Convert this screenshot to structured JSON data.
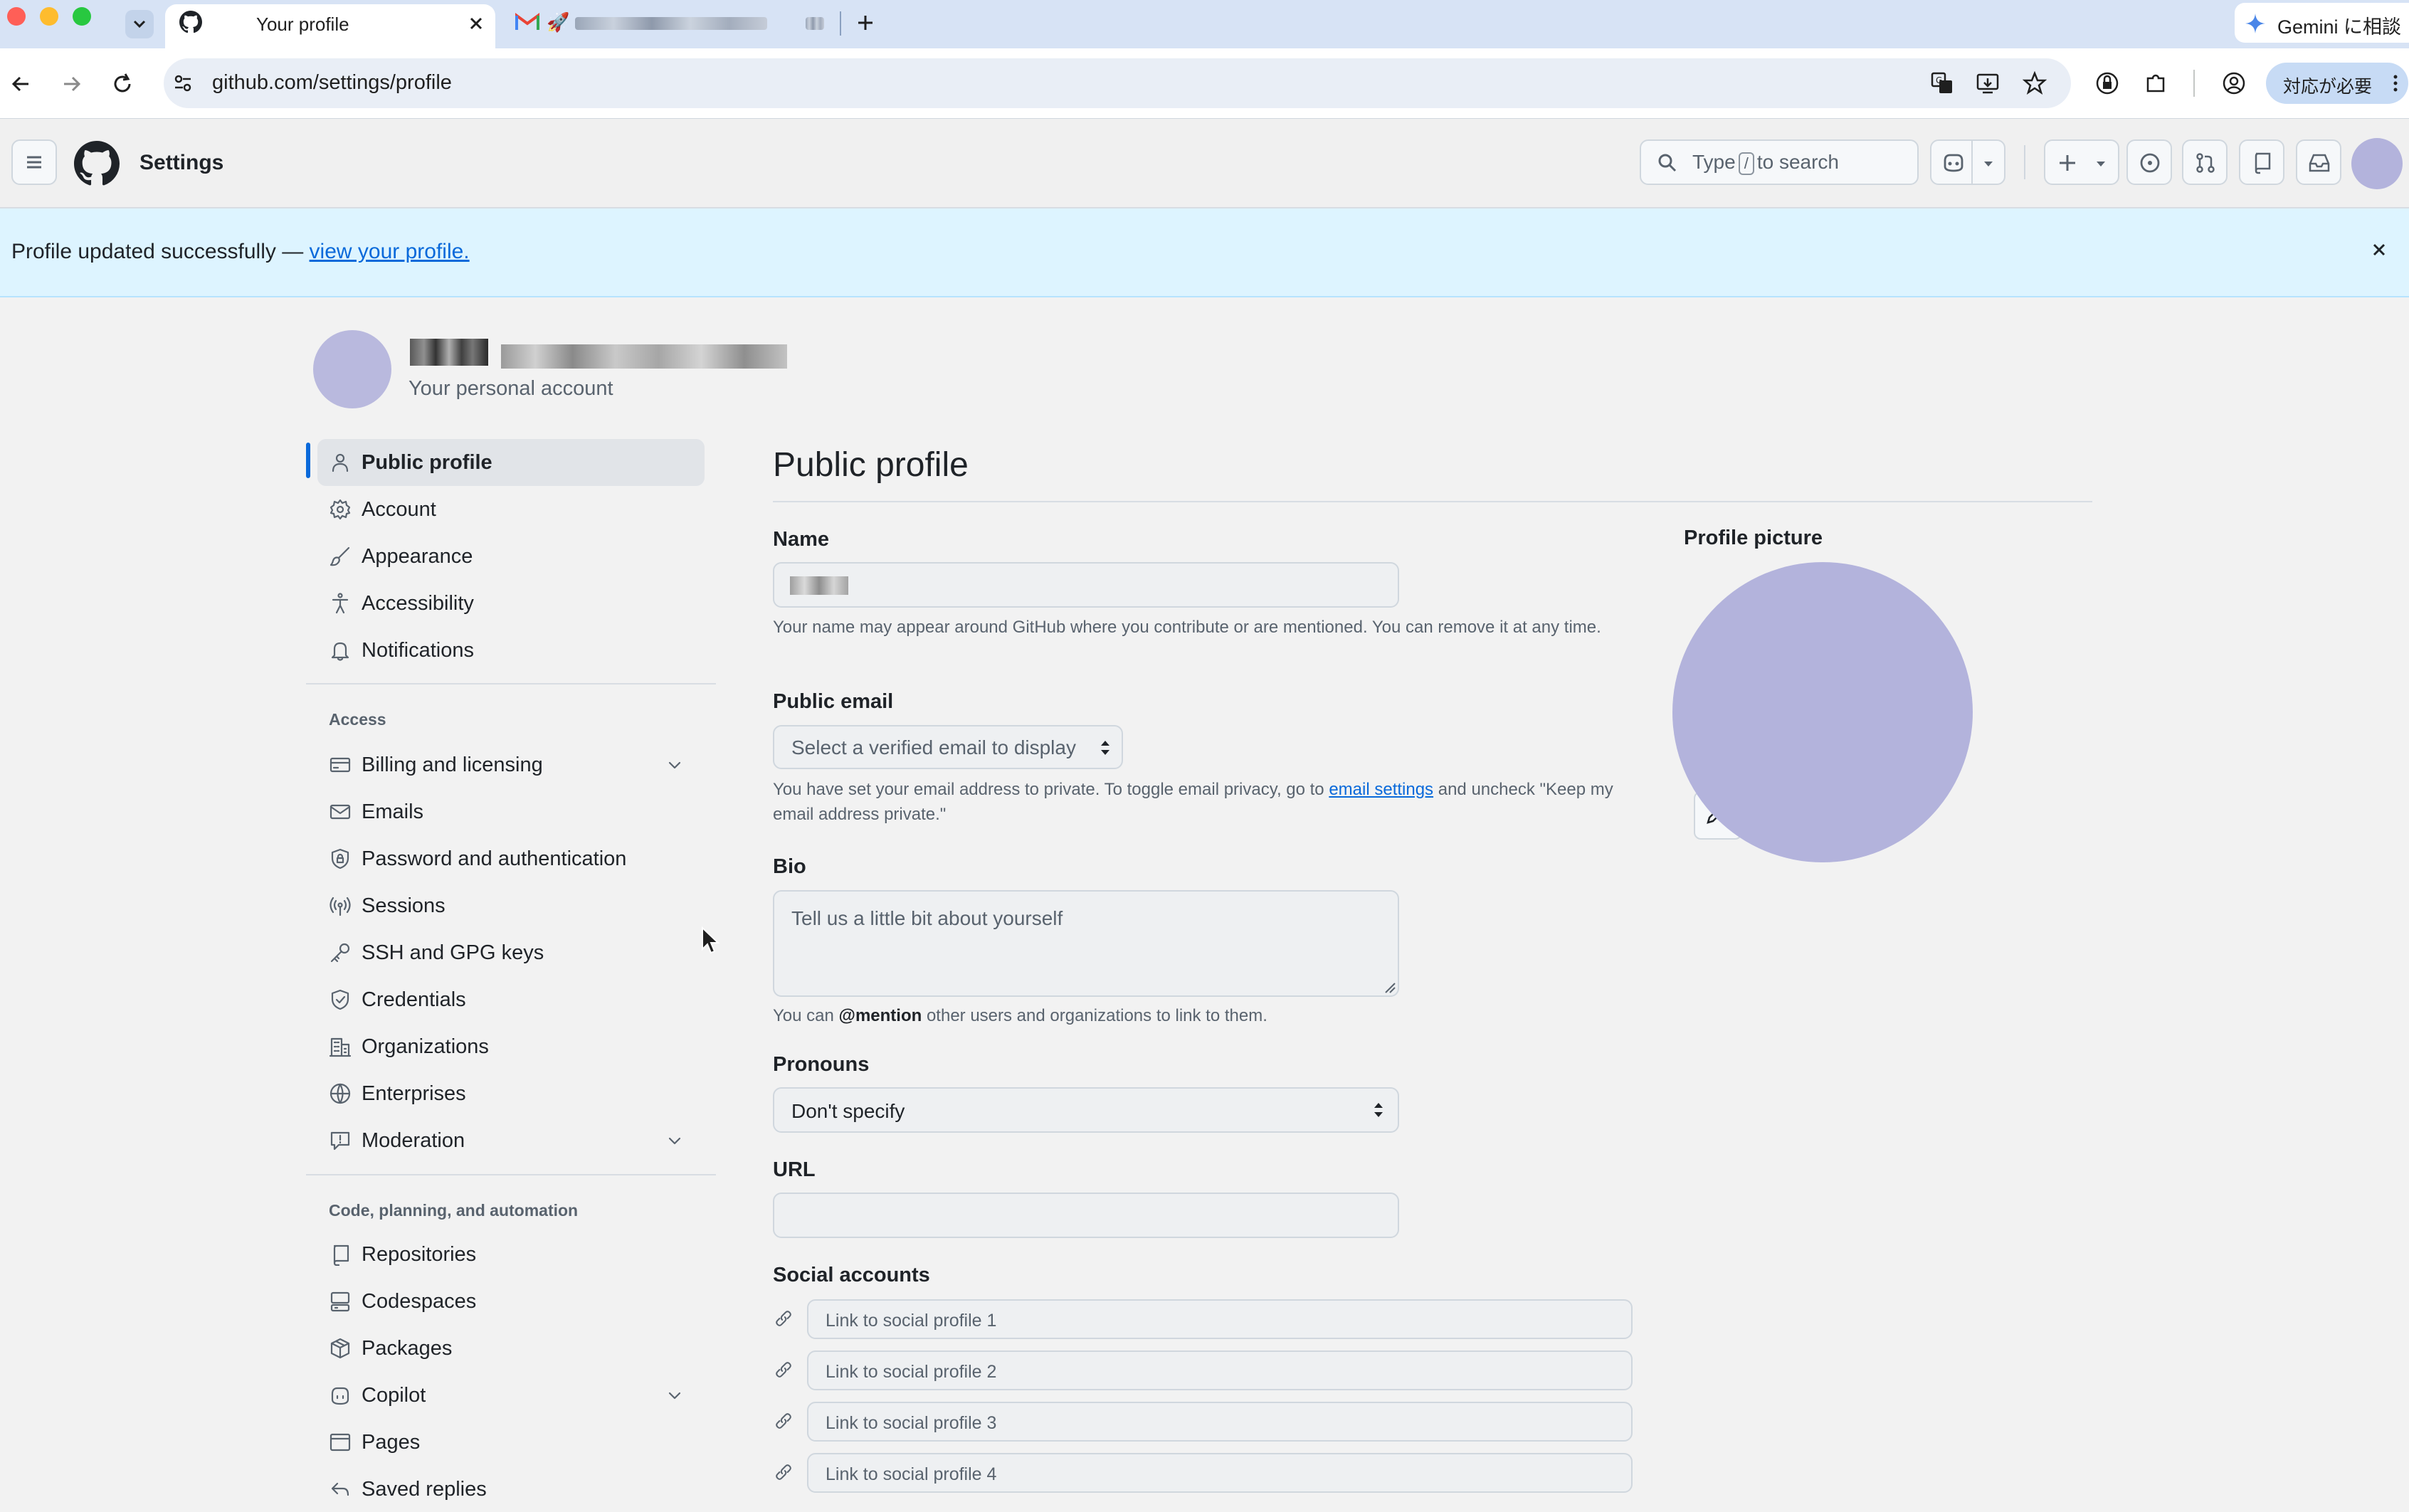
{
  "browser": {
    "active_tab_title": "Your profile",
    "url": "github.com/settings/profile",
    "gemini_label": "Gemini に相談",
    "attention_label": "対応が必要"
  },
  "header": {
    "title": "Settings",
    "search_prefix": "Type",
    "search_key": "/",
    "search_suffix": "to search"
  },
  "flash": {
    "message": "Profile updated successfully —",
    "link_text": "view your profile."
  },
  "account": {
    "subtitle": "Your personal account"
  },
  "sidebar": {
    "top_items": [
      {
        "label": "Public profile",
        "icon": "person-icon"
      },
      {
        "label": "Account",
        "icon": "gear-icon"
      },
      {
        "label": "Appearance",
        "icon": "paintbrush-icon"
      },
      {
        "label": "Accessibility",
        "icon": "accessibility-icon"
      },
      {
        "label": "Notifications",
        "icon": "bell-icon"
      }
    ],
    "access_heading": "Access",
    "access_items": [
      {
        "label": "Billing and licensing",
        "icon": "credit-card-icon",
        "expandable": true
      },
      {
        "label": "Emails",
        "icon": "mail-icon"
      },
      {
        "label": "Password and authentication",
        "icon": "shield-lock-icon"
      },
      {
        "label": "Sessions",
        "icon": "broadcast-icon"
      },
      {
        "label": "SSH and GPG keys",
        "icon": "key-icon"
      },
      {
        "label": "Credentials",
        "icon": "shield-check-icon"
      },
      {
        "label": "Organizations",
        "icon": "organization-icon"
      },
      {
        "label": "Enterprises",
        "icon": "globe-icon"
      },
      {
        "label": "Moderation",
        "icon": "report-icon",
        "expandable": true
      }
    ],
    "code_heading": "Code, planning, and automation",
    "code_items": [
      {
        "label": "Repositories",
        "icon": "repo-icon"
      },
      {
        "label": "Codespaces",
        "icon": "codespaces-icon"
      },
      {
        "label": "Packages",
        "icon": "package-icon"
      },
      {
        "label": "Copilot",
        "icon": "copilot-icon",
        "expandable": true
      },
      {
        "label": "Pages",
        "icon": "browser-icon"
      },
      {
        "label": "Saved replies",
        "icon": "reply-icon"
      }
    ]
  },
  "main": {
    "title": "Public profile",
    "name_label": "Name",
    "name_note": "Your name may appear around GitHub where you contribute or are mentioned. You can remove it at any time.",
    "email_label": "Public email",
    "email_select": "Select a verified email to display",
    "email_note_1": "You have set your email address to private. To toggle email privacy, go to",
    "email_note_link": "email settings",
    "email_note_2": "and uncheck \"Keep my email address private.\"",
    "bio_label": "Bio",
    "bio_placeholder": "Tell us a little bit about yourself",
    "bio_note_1": "You can",
    "bio_note_mention": "@mention",
    "bio_note_2": "other users and organizations to link to them.",
    "pronouns_label": "Pronouns",
    "pronouns_value": "Don't specify",
    "url_label": "URL",
    "url_value": "",
    "social_label": "Social accounts",
    "social_placeholders": [
      "Link to social profile 1",
      "Link to social profile 2",
      "Link to social profile 3",
      "Link to social profile 4"
    ],
    "profile_picture_label": "Profile picture"
  },
  "colors": {
    "accent": "#0969da",
    "avatar": "#b3b3dc",
    "flash_bg": "#ddf4ff",
    "active_indicator": "#0969da"
  }
}
